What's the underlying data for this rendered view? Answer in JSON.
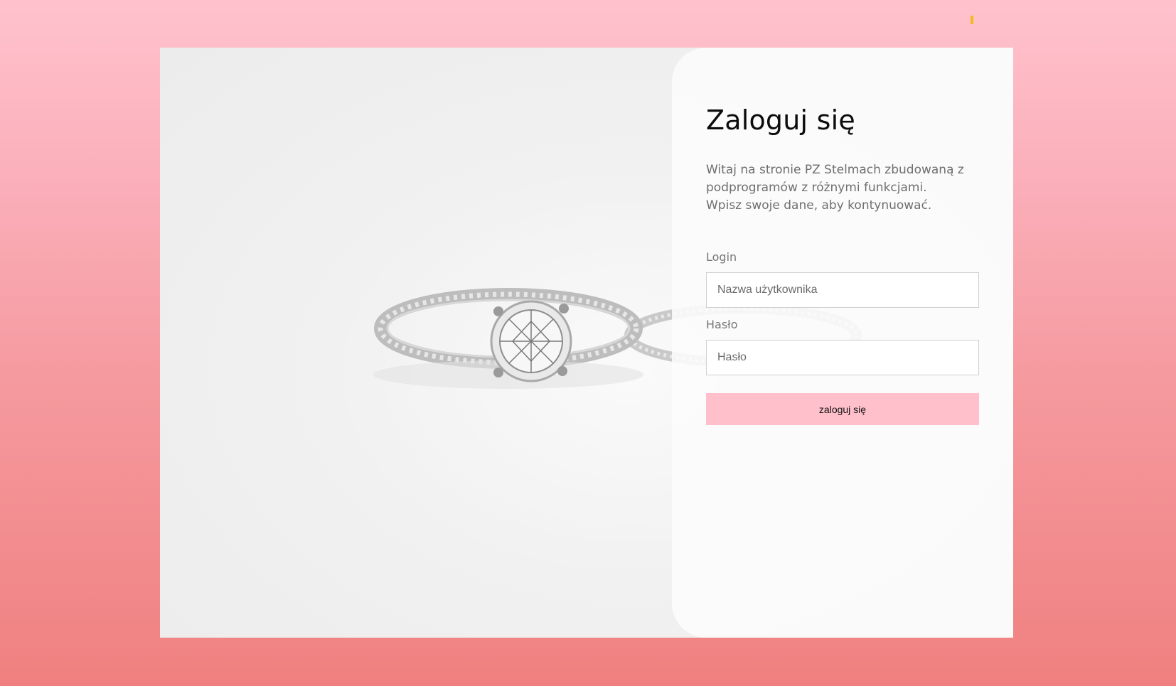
{
  "page": {
    "title": "Zaloguj się",
    "description_lines": [
      "Witaj na stronie PZ Stelmach zbudowaną z",
      "podprogramów z różnymi funkcjami.",
      "Wpisz swoje dane, aby kontynuować."
    ]
  },
  "form": {
    "login": {
      "label": "Login",
      "placeholder": "Nazwa użytkownika",
      "value": ""
    },
    "password": {
      "label": "Hasło",
      "placeholder": "Hasło",
      "value": ""
    },
    "submit_label": "zaloguj się"
  },
  "colors": {
    "background_top": "#ffc2cd",
    "background_bottom": "#f08080",
    "button": "#ffc0cb",
    "marker": "#f5b81f"
  },
  "image": {
    "subject": "diamond-ring-photo"
  }
}
